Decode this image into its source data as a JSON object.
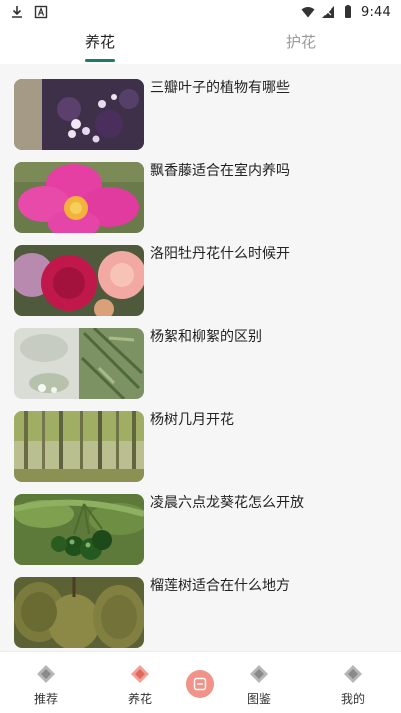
{
  "status_bar": {
    "time": "9:44",
    "left_icons": [
      "download-icon",
      "a-letter-icon"
    ],
    "right_icons": [
      "wifi-icon",
      "signal-icon",
      "battery-icon"
    ]
  },
  "tabs": [
    {
      "label": "养花",
      "active": true
    },
    {
      "label": "护花",
      "active": false
    }
  ],
  "accent_color": "#1a7a6d",
  "articles": [
    {
      "title": "三瓣叶子的植物有哪些",
      "image": "purple-oxalis-image"
    },
    {
      "title": "飘香藤适合在室内养吗",
      "image": "pink-mandevilla-image"
    },
    {
      "title": "洛阳牡丹花什么时候开",
      "image": "peony-image"
    },
    {
      "title": "杨絮和柳絮的区别",
      "image": "willow-catkin-image"
    },
    {
      "title": "杨树几月开花",
      "image": "poplar-forest-image"
    },
    {
      "title": "凌晨六点龙葵花怎么开放",
      "image": "nightshade-berries-image"
    },
    {
      "title": "榴莲树适合在什么地方",
      "image": "durian-image"
    }
  ],
  "bottom_nav": [
    {
      "label": "推荐",
      "icon": "recommend-icon",
      "active": false
    },
    {
      "label": "养花",
      "icon": "flower-care-icon",
      "active": true
    },
    {
      "label": "图鉴",
      "icon": "catalog-icon",
      "active": false
    },
    {
      "label": "我的",
      "icon": "profile-icon",
      "active": false
    }
  ],
  "center_button_icon": "scan-icon"
}
